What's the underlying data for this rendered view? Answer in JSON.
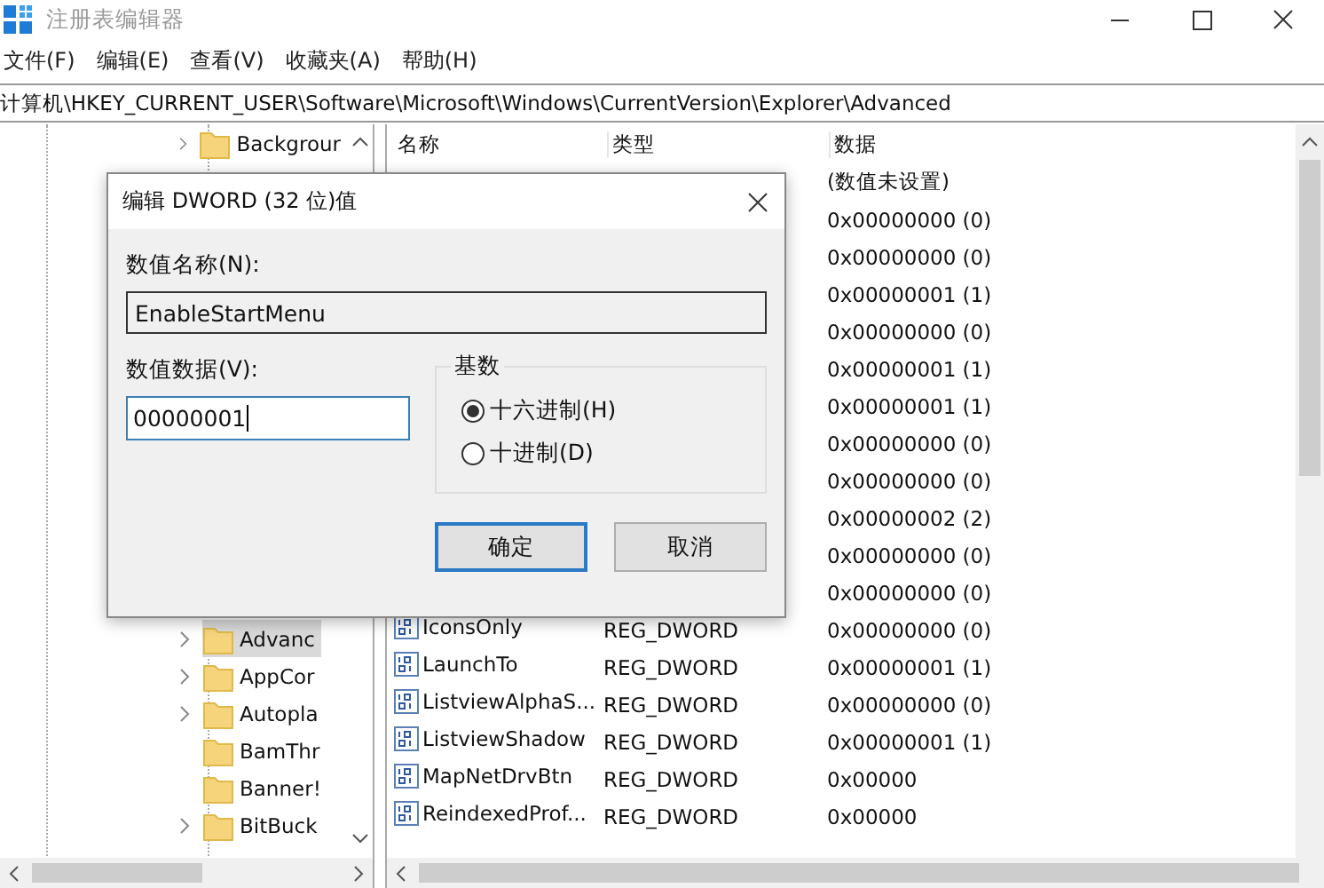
{
  "window": {
    "title": "注册表编辑器"
  },
  "menu": [
    "文件(F)",
    "编辑(E)",
    "查看(V)",
    "收藏夹(A)",
    "帮助(H)"
  ],
  "address": "计算机\\HKEY_CURRENT_USER\\Software\\Microsoft\\Windows\\CurrentVersion\\Explorer\\Advanced",
  "tree": {
    "top_items": [
      {
        "label": "Backgrour",
        "expandable": true,
        "selected": false
      }
    ],
    "bottom_items": [
      {
        "label": "Advanc",
        "expandable": true,
        "selected": true
      },
      {
        "label": "AppCor",
        "expandable": true,
        "selected": false
      },
      {
        "label": "Autopla",
        "expandable": true,
        "selected": false
      },
      {
        "label": "BamThr",
        "expandable": false,
        "selected": false
      },
      {
        "label": "Banner!",
        "expandable": false,
        "selected": false
      },
      {
        "label": "BitBuck",
        "expandable": true,
        "selected": false
      }
    ]
  },
  "table": {
    "columns": [
      "名称",
      "类型",
      "数据"
    ],
    "rows": [
      {
        "data": "(数值未设置)"
      },
      {
        "data": "0x00000000 (0)"
      },
      {
        "data": "0x00000000 (0)"
      },
      {
        "data": "0x00000001 (1)"
      },
      {
        "data": "0x00000000 (0)"
      },
      {
        "data": "0x00000001 (1)"
      },
      {
        "data": "0x00000001 (1)"
      },
      {
        "data": "0x00000000 (0)"
      },
      {
        "data": "0x00000000 (0)"
      },
      {
        "data": "0x00000002 (2)"
      },
      {
        "data": "0x00000000 (0)"
      },
      {
        "data": "0x00000000 (0)"
      },
      {
        "name": "IconsOnly",
        "type": "REG_DWORD",
        "data": "0x00000000 (0)"
      },
      {
        "name": "LaunchTo",
        "type": "REG_DWORD",
        "data": "0x00000001 (1)"
      },
      {
        "name": "ListviewAlphaS...",
        "type": "REG_DWORD",
        "data": "0x00000000 (0)"
      },
      {
        "name": "ListviewShadow",
        "type": "REG_DWORD",
        "data": "0x00000001 (1)"
      },
      {
        "name": "MapNetDrvBtn",
        "type": "REG_DWORD",
        "data": "0x00000"
      },
      {
        "name": "ReindexedProf...",
        "type": "REG_DWORD",
        "data": "0x00000"
      }
    ]
  },
  "dialog": {
    "title": "编辑 DWORD (32 位)值",
    "name_label": "数值名称(N):",
    "name_value": "EnableStartMenu",
    "data_label": "数值数据(V):",
    "data_value": "00000001",
    "base_group": "基数",
    "radios": [
      {
        "label": "十六进制(H)",
        "selected": true
      },
      {
        "label": "十进制(D)",
        "selected": false
      }
    ],
    "buttons": [
      {
        "label": "确定",
        "default": true
      },
      {
        "label": "取消",
        "default": false
      }
    ]
  }
}
